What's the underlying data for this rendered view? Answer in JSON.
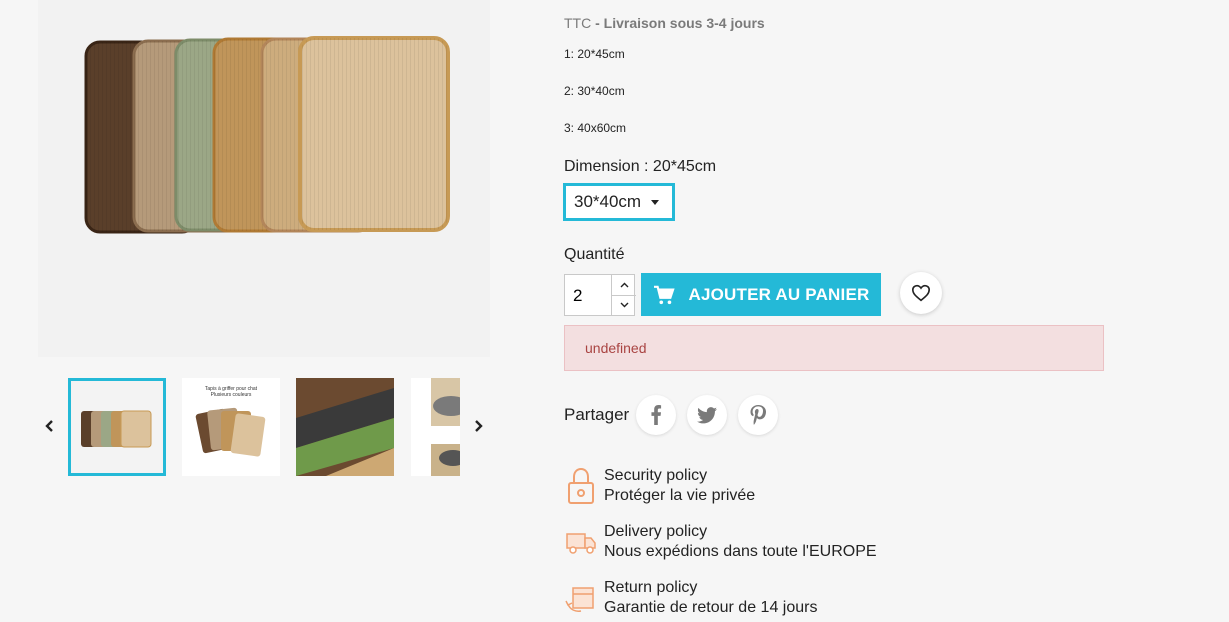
{
  "price_info": {
    "ttc": "TTC",
    "delivery": "- Livraison sous 3-4 jours"
  },
  "description": {
    "lines": [
      "1: 20*45cm",
      "2: 30*40cm",
      "3: 40x60cm"
    ]
  },
  "dimension": {
    "label": "Dimension : 20*45cm",
    "selected": "30*40cm"
  },
  "quantity": {
    "label": "Quantité",
    "value": "2"
  },
  "cart": {
    "add_label": "AJOUTER AU PANIER"
  },
  "alert": {
    "text": "undefined"
  },
  "share": {
    "label": "Partager",
    "networks": [
      "facebook-icon",
      "twitter-icon",
      "pinterest-icon"
    ]
  },
  "policies": [
    {
      "title": "Security policy",
      "text": "Protéger la vie privée",
      "icon": "lock-icon"
    },
    {
      "title": "Delivery policy",
      "text": "Nous expédions dans toute l'EUROPE",
      "icon": "truck-icon"
    },
    {
      "title": "Return policy",
      "text": "Garantie de retour de 14 jours",
      "icon": "return-box-icon"
    }
  ],
  "thumbnails": {
    "count_visible": 4,
    "second_thumb_caption_line1": "Tapis à griffer pour chat",
    "second_thumb_caption_line2": "Plusieurs couleurs"
  },
  "colors": {
    "accent": "#24b9d7",
    "alert_bg": "#f3dfe0",
    "alert_text": "#a94442"
  }
}
